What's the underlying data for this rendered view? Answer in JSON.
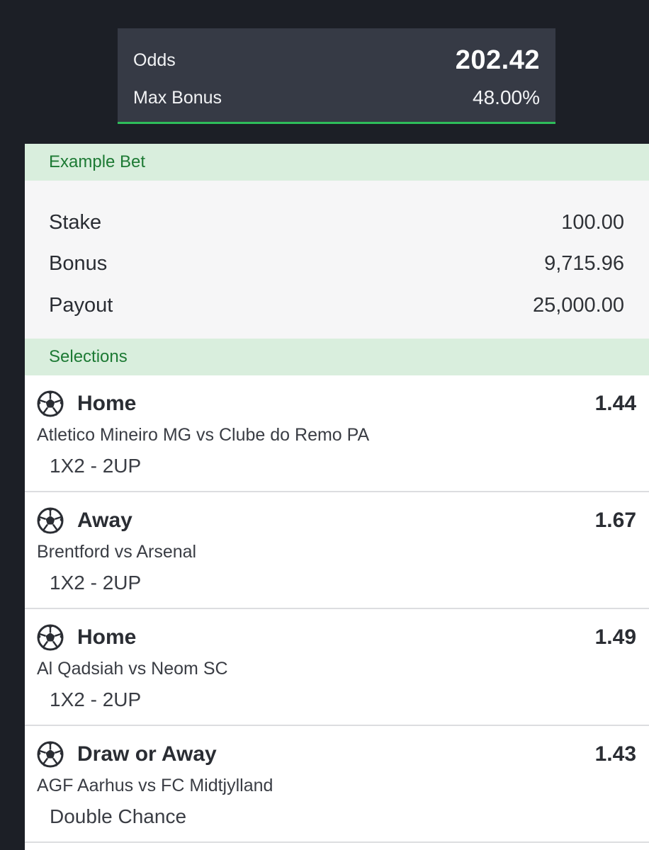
{
  "summary": {
    "odds_label": "Odds",
    "odds_value": "202.42",
    "bonus_label": "Max Bonus",
    "bonus_value": "48.00%"
  },
  "example_bet": {
    "header": "Example Bet",
    "rows": [
      {
        "label": "Stake",
        "value": "100.00"
      },
      {
        "label": "Bonus",
        "value": "9,715.96"
      },
      {
        "label": "Payout",
        "value": "25,000.00"
      }
    ]
  },
  "selections": {
    "header": "Selections",
    "items": [
      {
        "icon": "soccer-ball-icon",
        "pick": "Home",
        "odds": "1.44",
        "match": "Atletico Mineiro MG vs Clube do Remo PA",
        "market": "1X2 - 2UP"
      },
      {
        "icon": "soccer-ball-icon",
        "pick": "Away",
        "odds": "1.67",
        "match": "Brentford vs Arsenal",
        "market": "1X2 - 2UP"
      },
      {
        "icon": "soccer-ball-icon",
        "pick": "Home",
        "odds": "1.49",
        "match": "Al Qadsiah vs Neom SC",
        "market": "1X2 - 2UP"
      },
      {
        "icon": "soccer-ball-icon",
        "pick": "Draw or Away",
        "odds": "1.43",
        "match": "AGF Aarhus vs FC Midtjylland",
        "market": "Double Chance"
      }
    ]
  },
  "colors": {
    "background": "#1c1f26",
    "card": "#363a45",
    "accent_green": "#2ebd5a",
    "section_header_bg": "#d9eedd",
    "section_header_text": "#1d7a34"
  }
}
